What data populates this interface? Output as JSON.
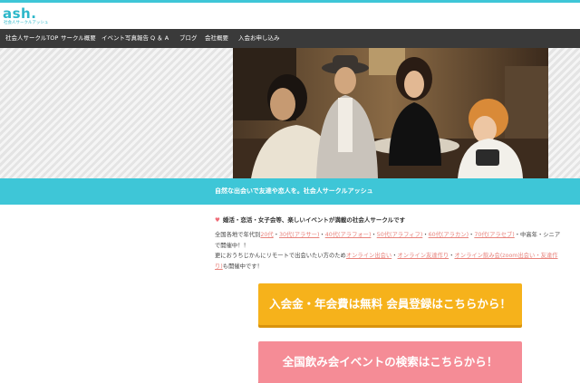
{
  "brand": {
    "logo": "ash.",
    "tagline": "社会人サークルアッシュ",
    "accent_color": "#3ec6d7"
  },
  "nav": {
    "items": [
      {
        "label": "社会人サークルTOP"
      },
      {
        "label": "サークル概要"
      },
      {
        "label": "イベント写真報告"
      },
      {
        "label": "Q ＆ A"
      },
      {
        "label": "ブログ"
      },
      {
        "label": "会社概要"
      },
      {
        "label": "入会お申し込み"
      }
    ]
  },
  "hero": {
    "band_text": "自然な出会いで友達や恋人を。社会人サークルアッシュ"
  },
  "intro": {
    "heart_icon": "heart-icon",
    "catch": "婚活・恋活・女子会等、楽しいイベントが満載の社会人サークルです",
    "line1_prefix": "全国各地で年代別",
    "age_links": [
      "20代",
      "30代(アラサー)",
      "40代(アラフォー)",
      "50代(アラフィフ)",
      "60代(アラカン)",
      "70代(アラセブ)"
    ],
    "sep": "・",
    "line1_suffix": "・中高年・シニアで開催中！！",
    "line2_prefix": "更におうちじかんにリモートで出会いたい方のため",
    "online_links": [
      "オンライン出会い",
      "オンライン友達作り",
      "オンライン飲み会(zoom出会い・友達作り)"
    ],
    "line2_suffix": "も開催中です！"
  },
  "cta": {
    "register_label": "入会金・年会費は無料 会員登録はこちらから！",
    "register_color": "#f6b21b",
    "search_label": "全国飲み会イベントの検索はこちらから！",
    "search_color": "#f58c96"
  }
}
